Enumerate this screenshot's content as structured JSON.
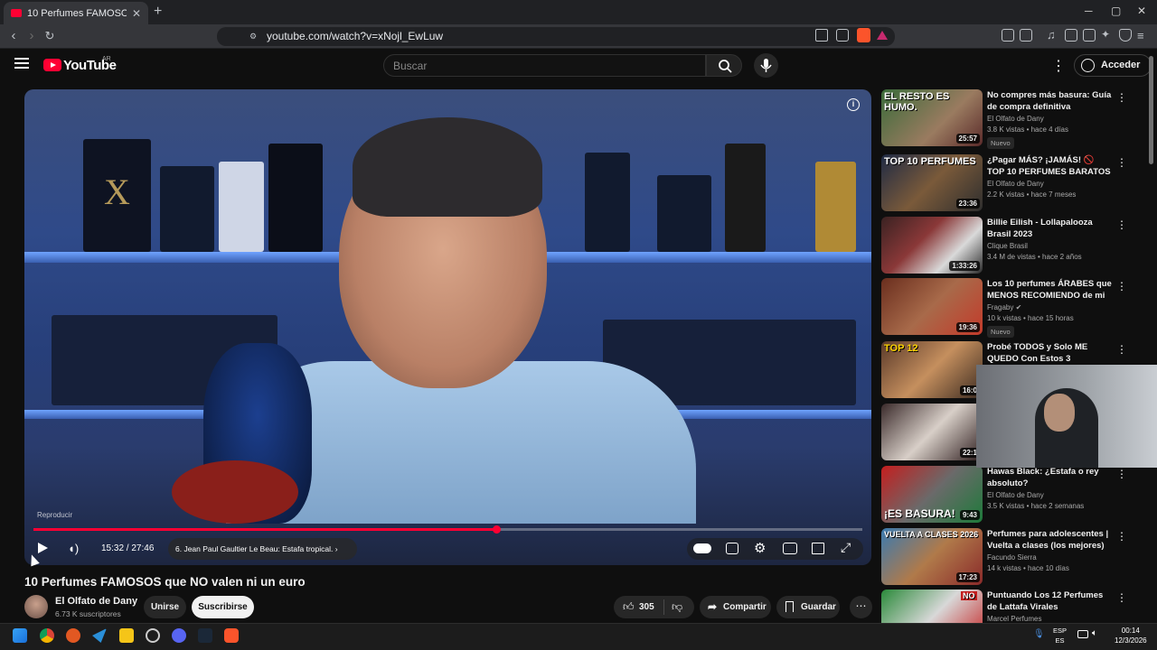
{
  "browser": {
    "tab_title": "10 Perfumes FAMOSOS que NO",
    "new_tab": "+",
    "url": "youtube.com/watch?v=xNojl_EwLuw",
    "window_controls": [
      "─",
      "▢",
      "✕"
    ]
  },
  "header": {
    "logo": "YouTube",
    "country": "AR",
    "search_placeholder": "Buscar",
    "signin": "Acceder"
  },
  "player": {
    "label": "Reproducir",
    "time": "15:32 / 27:46",
    "progress": 0.559,
    "chapter": "6. Jean Paul Gaultier Le Beau: Estafa tropical.",
    "info": "i"
  },
  "video": {
    "title": "10 Perfumes FAMOSOS que NO valen ni un euro",
    "channel": "El Olfato de Dany",
    "subscribers": "6.73 K suscriptores",
    "join": "Unirse",
    "subscribe": "Suscribirse",
    "likes": "305",
    "share": "Compartir",
    "save": "Guardar"
  },
  "sidebar": [
    {
      "title": "No compres más basura: Guía de compra definitiva",
      "channel": "El Olfato de Dany",
      "meta": "3.8 K vistas • hace 4 días",
      "duration": "25:57",
      "badge": "Nuevo",
      "overlay": "EL RESTO ES HUMO."
    },
    {
      "title": "¿Pagar MÁS? ¡JAMÁS! 🚫 TOP 10 PERFUMES BARATOS que ...",
      "channel": "El Olfato de Dany",
      "meta": "2.2 K vistas • hace 7 meses",
      "duration": "23:36",
      "badge": "",
      "overlay": "TOP 10 PERFUMES"
    },
    {
      "title": "Billie Eilish - Lollapalooza Brasil 2023",
      "channel": "Clique Brasil",
      "meta": "3.4 M de vistas • hace 2 años",
      "duration": "1:33:26",
      "badge": "",
      "overlay": ""
    },
    {
      "title": "Los 10 perfumes ÁRABES que MENOS RECOMIENDO de mi ...",
      "channel": "Fragaby",
      "meta": "10 k vistas • hace 15 horas",
      "duration": "19:36",
      "badge": "Nuevo",
      "overlay": ""
    },
    {
      "title": "Probé TODOS y Solo ME QUEDO Con Estos 3",
      "channel": "",
      "meta": "",
      "duration": "16:0",
      "badge": "",
      "overlay": "TOP 12"
    },
    {
      "title": "",
      "channel": "",
      "meta": "",
      "duration": "22:1",
      "badge": "",
      "overlay": ""
    },
    {
      "title": "Hawas Black: ¿Estafa o rey absoluto?",
      "channel": "El Olfato de Dany",
      "meta": "3.5 K vistas • hace 2 semanas",
      "duration": "9:43",
      "badge": "",
      "overlay": "¡ES BASURA!"
    },
    {
      "title": "Perfumes para adolescentes | Vuelta a clases (los mejores)",
      "channel": "Facundo Sierra",
      "meta": "14 k vistas • hace 10 días",
      "duration": "17:23",
      "badge": "",
      "overlay": "VUELTA A CLASES 2026"
    },
    {
      "title": "Puntuando Los 12 Perfumes de Lattafa Virales",
      "channel": "Marcel Perfumes",
      "meta": "",
      "duration": "",
      "badge": "",
      "overlay": "NO"
    }
  ],
  "taskbar": {
    "lang_top": "ESP",
    "lang_bottom": "ES",
    "time": "00:14",
    "date": "12/3/2026"
  },
  "colors": {
    "accent": "#ff0033",
    "background": "#0f0f0f",
    "chip": "#272727"
  }
}
